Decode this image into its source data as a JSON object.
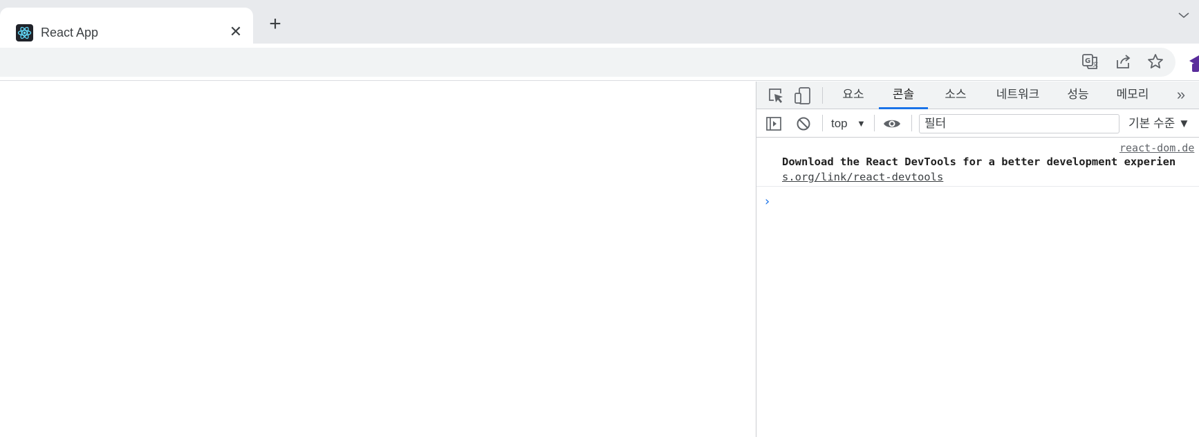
{
  "browser": {
    "tab": {
      "title": "React App",
      "close_glyph": "✕"
    },
    "new_tab_glyph": "+",
    "icons": [
      "react-favicon-icon",
      "close-icon",
      "plus-icon",
      "chevron-down-icon",
      "translate-icon",
      "share-icon",
      "star-icon",
      "extension-icon"
    ]
  },
  "devtools": {
    "tabs": [
      "요소",
      "콘솔",
      "소스",
      "네트워크",
      "성능",
      "메모리"
    ],
    "active_tab": "콘솔",
    "more_tabs_glyph": "»",
    "console_toolbar": {
      "context": "top",
      "filter_placeholder": "필터",
      "levels": "기본 수준 ▼"
    },
    "messages": [
      {
        "source": "react-dom.de",
        "text": "Download the React DevTools for a better development experien",
        "link": "s.org/link/react-devtools"
      }
    ],
    "prompt_glyph": "›"
  },
  "colors": {
    "accent": "#1a73e8",
    "tabstrip": "#e8eaed",
    "devtools_bar": "#f1f3f4",
    "react_bg": "#20232a",
    "react_cyan": "#61dafb"
  }
}
